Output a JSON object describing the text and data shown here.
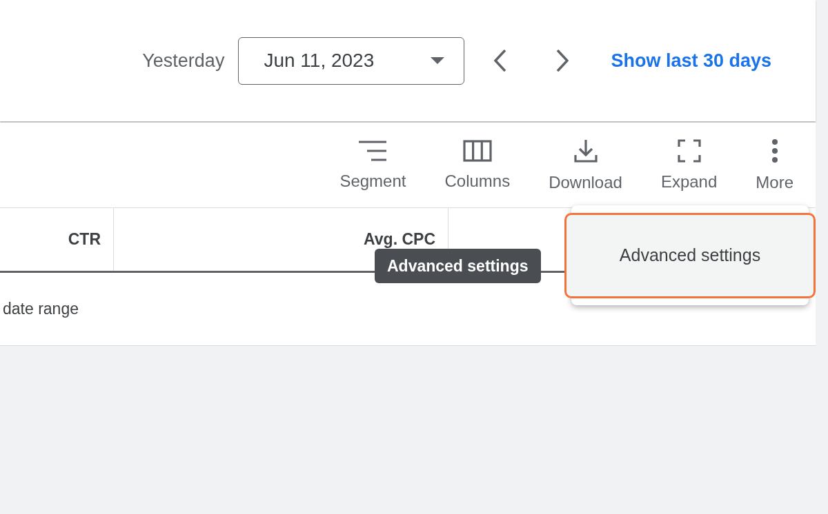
{
  "date_bar": {
    "label": "Yesterday",
    "date": "Jun 11, 2023",
    "link": "Show last 30 days"
  },
  "toolbar": [
    {
      "kind": "segment",
      "label": "Segment"
    },
    {
      "kind": "columns",
      "label": "Columns"
    },
    {
      "kind": "download",
      "label": "Download"
    },
    {
      "kind": "expand",
      "label": "Expand"
    },
    {
      "kind": "more",
      "label": "More"
    }
  ],
  "table": {
    "columns": [
      "CTR",
      "Avg. CPC"
    ],
    "rows": [
      [
        "date range"
      ]
    ]
  },
  "tooltip": "Advanced settings",
  "menu": {
    "items": [
      {
        "label": "Advanced settings",
        "selected": true
      }
    ]
  }
}
